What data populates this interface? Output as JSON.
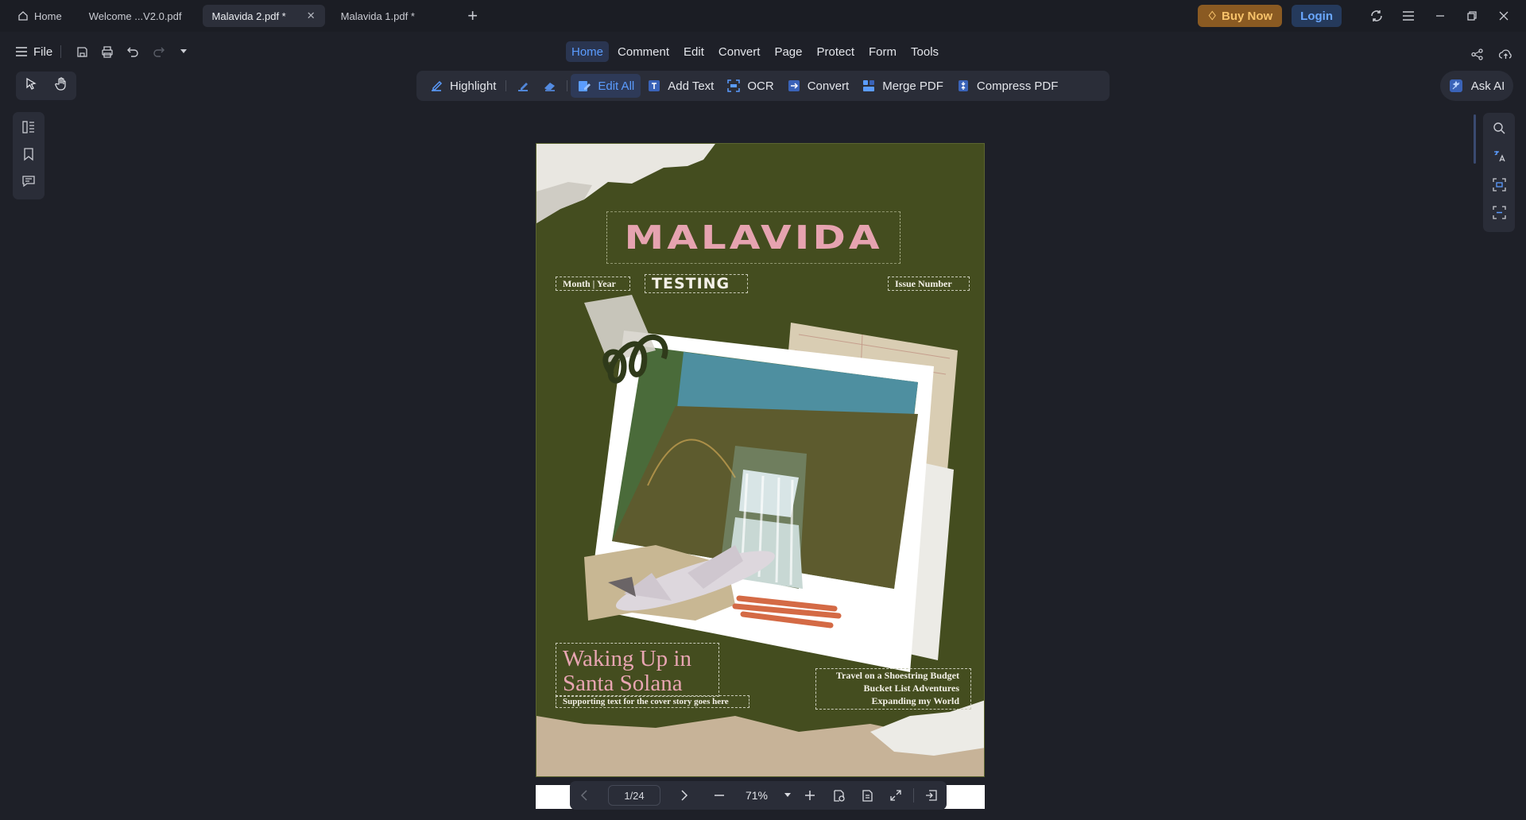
{
  "tabs": [
    {
      "label": "Home"
    },
    {
      "label": "Welcome ...V2.0.pdf"
    },
    {
      "label": "Malavida 2.pdf *"
    },
    {
      "label": "Malavida 1.pdf *"
    }
  ],
  "titlebar": {
    "buy_now": "Buy Now",
    "login": "Login"
  },
  "file_menu": {
    "label": "File"
  },
  "main_menu": [
    "Home",
    "Comment",
    "Edit",
    "Convert",
    "Page",
    "Protect",
    "Form",
    "Tools"
  ],
  "toolbar": {
    "highlight": "Highlight",
    "edit_all": "Edit All",
    "add_text": "Add Text",
    "ocr": "OCR",
    "convert": "Convert",
    "merge_pdf": "Merge PDF",
    "compress_pdf": "Compress PDF"
  },
  "ask_ai": "Ask AI",
  "document": {
    "magazine_title": "MALAVIDA",
    "month_year": "Month | Year",
    "testing": "TESTING",
    "issue_number": "Issue Number",
    "story_title_line1": "Waking Up in",
    "story_title_line2": "Santa Solana",
    "supporting_text": "Supporting text for the cover story goes here",
    "cover_line1": "Travel on a Shoestring Budget",
    "cover_line2": "Bucket List Adventures",
    "cover_line3": "Expanding my World"
  },
  "navigation": {
    "page_indicator": "1/24",
    "zoom": "71%"
  },
  "colors": {
    "accent": "#5b9cff",
    "page_background": "#444d1f",
    "title_pink": "#e6a3b0",
    "buy_now": "#f7c26a"
  }
}
